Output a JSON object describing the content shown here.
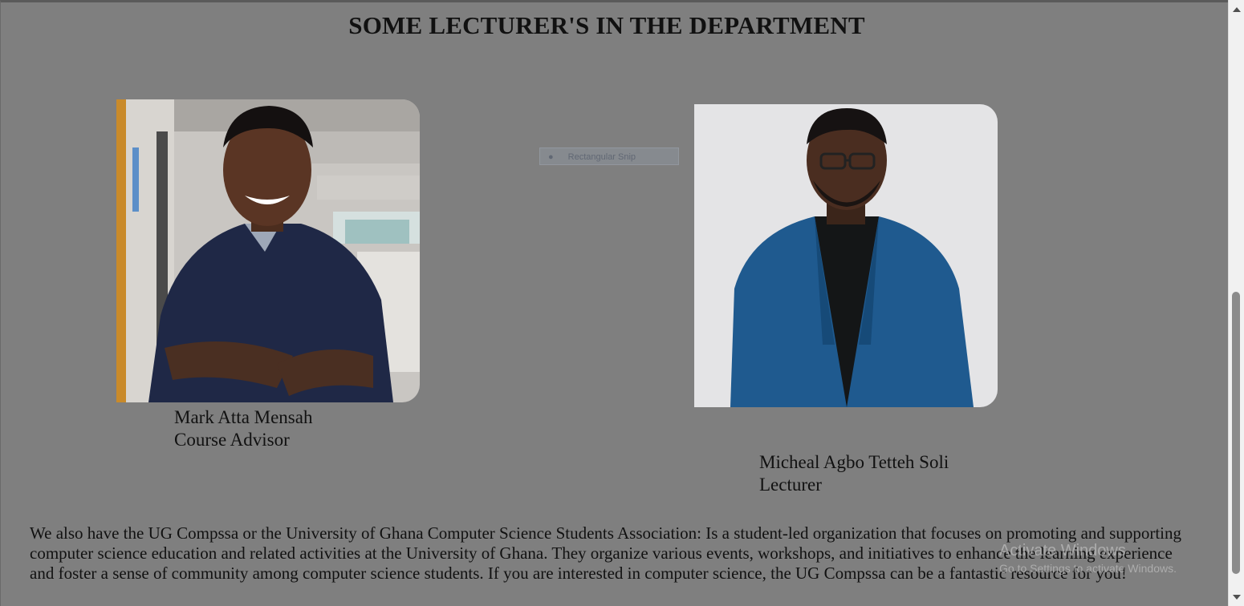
{
  "section": {
    "title": "SOME LECTURER'S IN THE DEPARTMENT"
  },
  "lecturers": [
    {
      "name": "Mark Atta Mensah",
      "role": "Course Advisor"
    },
    {
      "name": "Micheal Agbo Tetteh Soli",
      "role": "Lecturer"
    }
  ],
  "ghost_snip": {
    "label": "Rectangular Snip"
  },
  "description": "We also have the UG Compssa or the University of Ghana Computer Science Students Association: Is a student-led organization that focuses on promoting and supporting computer science education and related activities at the University of Ghana. They organize various events, workshops, and initiatives to enhance the learning experience and foster a sense of community among computer science students. If you are interested in computer science, the UG Compssa can be a fantastic resource for you!",
  "watermark": {
    "line1": "Activate Windows",
    "line2": "Go to Settings to activate Windows."
  },
  "colors": {
    "page_background": "#7f7f7f",
    "text": "#111111",
    "scrollbar_track": "#f1f1f1",
    "scrollbar_thumb": "#8b8b8b"
  }
}
